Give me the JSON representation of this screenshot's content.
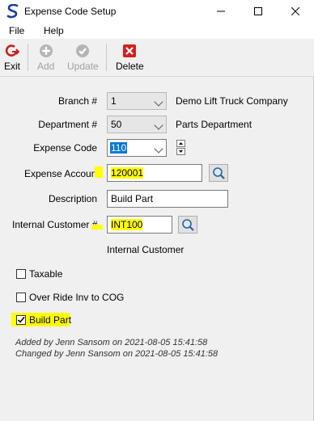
{
  "window": {
    "title": "Expense Code Setup",
    "minimize": "—",
    "maximize": "☐",
    "close": "✕"
  },
  "menu": {
    "file": "File",
    "help": "Help"
  },
  "toolbar": {
    "exit": "Exit",
    "add": "Add",
    "update": "Update",
    "delete": "Delete"
  },
  "form": {
    "branch_label": "Branch #",
    "branch_value": "1",
    "branch_name": "Demo Lift Truck Company",
    "department_label": "Department #",
    "department_value": "50",
    "department_name": "Parts Department",
    "expense_code_label": "Expense Code",
    "expense_code_value": "110",
    "expense_account_label": "Expense Account",
    "expense_account_value": "120001",
    "description_label": "Description",
    "description_value": "Build Part",
    "internal_customer_label": "Internal Customer #",
    "internal_customer_value": "INT100",
    "internal_customer_name": "Internal Customer"
  },
  "checkboxes": {
    "taxable": {
      "label": "Taxable",
      "checked": false
    },
    "override": {
      "label": "Over Ride Inv to COG",
      "checked": false
    },
    "build_part": {
      "label": "Build Part",
      "checked": true
    }
  },
  "audit": {
    "added": "Added by Jenn Sansom on 2021-08-05 15:41:58",
    "changed": "Changed by Jenn Sansom on 2021-08-05 15:41:58"
  },
  "colors": {
    "highlight": "#ffff00",
    "selection": "#0078d7"
  }
}
